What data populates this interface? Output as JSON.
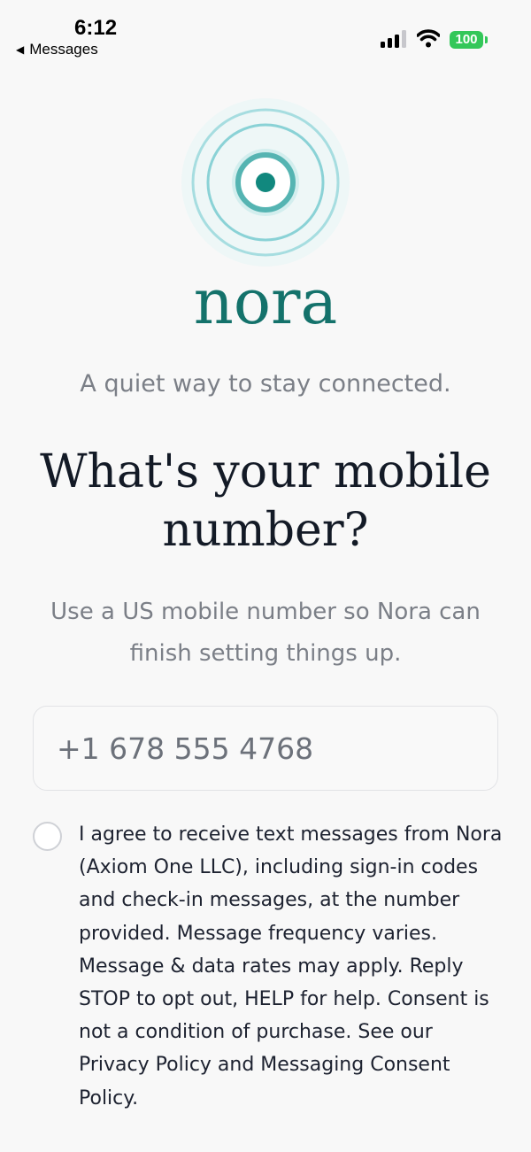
{
  "status_bar": {
    "time": "6:12",
    "back_label": "Messages",
    "battery": "100",
    "battery_color": "#33c759"
  },
  "brand": {
    "name": "nora",
    "tagline": "A quiet way to stay connected.",
    "color": "#14726b"
  },
  "form": {
    "heading": "What's your mobile number?",
    "subtext": "Use a US mobile number so Nora can finish setting things up.",
    "phone_value": "+1 678 555 4768",
    "consent_checked": false,
    "consent_text": "I agree to receive text messages from Nora (Axiom One LLC), including sign-in codes and check-in messages, at the number provided. Message frequency varies. Message & data rates may apply. Reply STOP to opt out, HELP for help. Consent is not a condition of purchase. See our Privacy Policy and Messaging Consent Policy."
  },
  "icons": [
    "back-triangle-icon",
    "cellular-signal-icon",
    "wifi-icon",
    "battery-icon",
    "nora-logo-icon"
  ]
}
